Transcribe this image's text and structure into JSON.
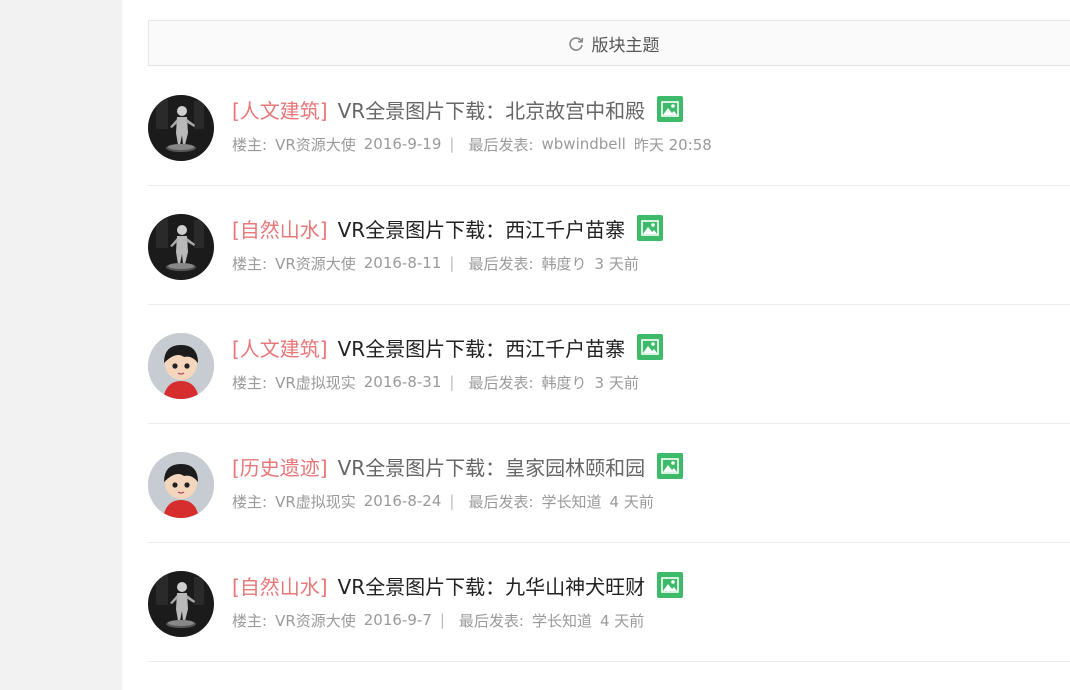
{
  "section_bar": {
    "label": "版块主题"
  },
  "threads": [
    {
      "category": "[人文建筑]",
      "title": "VR全景图片下载：北京故宫中和殿",
      "title_visited": true,
      "owner_label": "楼主:",
      "owner": "VR资源大使",
      "date": "2016-9-19",
      "last_post_label": "最后发表:",
      "last_poster": "wbwindbell",
      "last_time": "昨天 20:58",
      "avatar": "statue"
    },
    {
      "category": "[自然山水]",
      "title": "VR全景图片下载：西江千户苗寨",
      "title_visited": false,
      "owner_label": "楼主:",
      "owner": "VR资源大使",
      "date": "2016-8-11",
      "last_post_label": "最后发表:",
      "last_poster": "韩度り",
      "last_time": "3 天前",
      "avatar": "statue"
    },
    {
      "category": "[人文建筑]",
      "title": "VR全景图片下载：西江千户苗寨",
      "title_visited": false,
      "owner_label": "楼主:",
      "owner": "VR虚拟现实",
      "date": "2016-8-31",
      "last_post_label": "最后发表:",
      "last_poster": "韩度り",
      "last_time": "3 天前",
      "avatar": "cartoon"
    },
    {
      "category": "[历史遗迹]",
      "title": "VR全景图片下载：皇家园林颐和园",
      "title_visited": true,
      "owner_label": "楼主:",
      "owner": "VR虚拟现实",
      "date": "2016-8-24",
      "last_post_label": "最后发表:",
      "last_poster": "学长知道",
      "last_time": "4 天前",
      "avatar": "cartoon"
    },
    {
      "category": "[自然山水]",
      "title": "VR全景图片下载：九华山神犬旺财",
      "title_visited": false,
      "owner_label": "楼主:",
      "owner": "VR资源大使",
      "date": "2016-9-7",
      "last_post_label": "最后发表:",
      "last_poster": "学长知道",
      "last_time": "4 天前",
      "avatar": "statue"
    }
  ],
  "colors": {
    "category": "#e8777a",
    "image_badge": "#3dbb6a",
    "meta": "#9a9a9a"
  },
  "icons": {
    "section_bar": "refresh-icon",
    "attachment": "image-icon"
  }
}
